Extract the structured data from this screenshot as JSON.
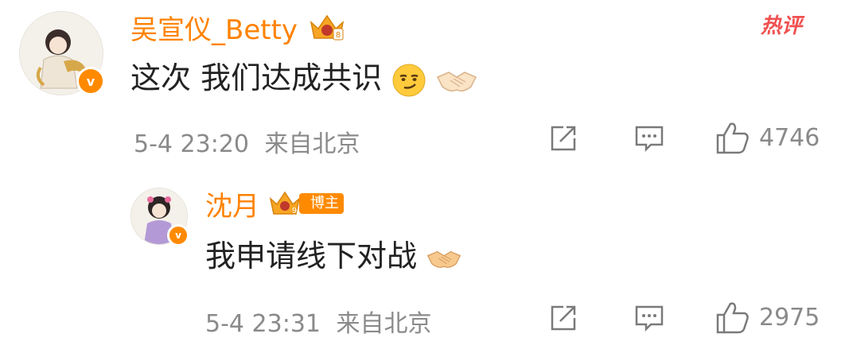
{
  "hot_badge": "热评",
  "comments": [
    {
      "author": "吴宣仪_Betty",
      "text": "这次 我们达成共识",
      "emojis": [
        "smirk-emoji",
        "handshake-emoji"
      ],
      "date": "5-4 23:20",
      "location": "来自北京",
      "likes": "4746"
    },
    {
      "author": "沈月",
      "badge": "博主",
      "text": "我申请线下对战",
      "emojis": [
        "handshake-emoji"
      ],
      "date": "5-4 23:31",
      "location": "来自北京",
      "likes": "2975"
    }
  ],
  "colors": {
    "name": "#ff8200",
    "meta": "#8a8a8a",
    "hot": "#f05050",
    "text": "#222222"
  }
}
